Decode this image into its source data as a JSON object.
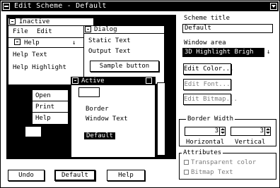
{
  "window": {
    "title": "Edit Scheme - Default"
  },
  "preview": {
    "inactive": {
      "title": "Inactive",
      "menu": [
        "File",
        "Edit"
      ]
    },
    "help_menu_title": "Help",
    "dialog": {
      "title": "Dialog",
      "static_text": "Static Text",
      "output_text": "Output Text",
      "sample_button": "Sample button"
    },
    "help_items": [
      "Help Text",
      "Help Highlight"
    ],
    "popup": {
      "items": [
        "Open",
        "Print",
        "Help"
      ]
    },
    "active": {
      "title": "Active",
      "text_a": "Border",
      "text_b": "Window Text",
      "selected": "Default"
    }
  },
  "scheme_title": {
    "label": "Scheme title",
    "value": "Default"
  },
  "window_area": {
    "label": "Window area",
    "value": "3D Highlight Brigh"
  },
  "buttons": {
    "edit_color": "Edit Color...",
    "edit_font": "Edit Font...",
    "edit_bitmap": "Edit Bitmap...",
    "undo": "Undo",
    "default": "Default",
    "help": "Help"
  },
  "border_width": {
    "label": "Border Width",
    "horizontal": {
      "label": "Horizontal",
      "value": "3"
    },
    "vertical": {
      "label": "Vertical",
      "value": "3"
    }
  },
  "attributes": {
    "label": "Attributes",
    "transparent": "Transparent color",
    "bitmap_text": "Bitmap Text"
  },
  "colors": {
    "titlebar": "#000000",
    "background": "#ffffff",
    "disabled": "#7d7d7d"
  }
}
